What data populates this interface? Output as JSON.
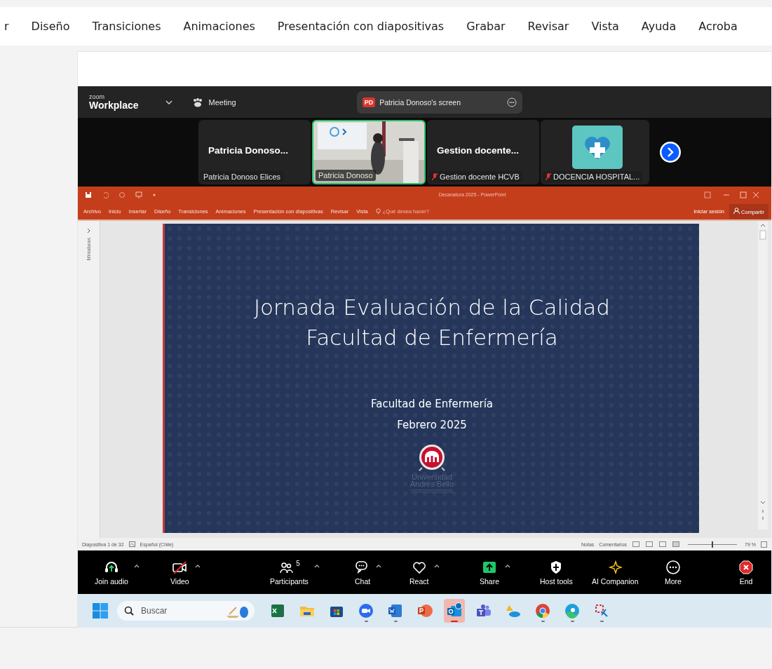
{
  "menu": [
    {
      "label": "r"
    },
    {
      "label": "Diseño"
    },
    {
      "label": "Transiciones"
    },
    {
      "label": "Animaciones"
    },
    {
      "label": "Presentación con diapositivas"
    },
    {
      "label": "Grabar"
    },
    {
      "label": "Revisar"
    },
    {
      "label": "Vista"
    },
    {
      "label": "Ayuda"
    },
    {
      "label": "Acroba"
    }
  ],
  "zoom_header": {
    "brand_small": "zoom",
    "brand": "Workplace",
    "meeting": "Meeting",
    "share_pill": {
      "initials": "PD",
      "label": "Patricia Donoso's screen"
    }
  },
  "participants": [
    {
      "kind": "name",
      "title": "Patricia Donoso...",
      "caption": "Patricia Donoso Elices",
      "muted": false,
      "selected": false
    },
    {
      "kind": "video",
      "caption": "Patricia Donoso",
      "muted": false,
      "selected": true
    },
    {
      "kind": "name",
      "title": "Gestion docente...",
      "caption": "Gestion docente HCVB",
      "muted": true,
      "selected": false
    },
    {
      "kind": "avatar",
      "caption": "DOCENCIA HOSPITAL...",
      "muted": true,
      "selected": false
    }
  ],
  "powerpoint": {
    "title": "Decanatura 2025 - PowerPoint",
    "tabs": [
      "Archivo",
      "Inicio",
      "Insertar",
      "Diseño",
      "Transiciones",
      "Animaciones",
      "Presentación con diapositivas",
      "Revisar",
      "Vista"
    ],
    "tell_me": "¿Qué desea hacer?",
    "sign_in": "Iniciar sesión",
    "share": "Compartir",
    "thumbnails": "Miniaturas",
    "slide": {
      "title": [
        "Jornada Evaluación de la Calidad",
        "Facultad de Enfermería"
      ],
      "subtitle": [
        "Facultad de Enfermería",
        "Febrero 2025"
      ],
      "logo_text": [
        "Universidad",
        "Andrés Bello"
      ]
    },
    "status_bar": {
      "slide": "Diapositiva 1 de 32",
      "language": "Español (Chile)",
      "notes": "Notas",
      "comments": "Comentarios",
      "zoom": "79 %",
      "level": 0.5
    }
  },
  "toolbar": [
    {
      "kind": "audio",
      "label": "Join audio",
      "caret": true
    },
    {
      "kind": "video",
      "label": "Video",
      "caret": true,
      "muted": true
    },
    {
      "kind": "participants",
      "label": "Participants",
      "count": "5",
      "caret": true
    },
    {
      "kind": "chat",
      "label": "Chat",
      "caret": true
    },
    {
      "kind": "react",
      "label": "React",
      "caret": true
    },
    {
      "kind": "share",
      "label": "Share",
      "caret": true
    },
    {
      "kind": "host",
      "label": "Host tools",
      "caret": false
    },
    {
      "kind": "ai",
      "label": "AI Companion",
      "caret": false
    },
    {
      "kind": "more",
      "label": "More",
      "caret": false
    },
    {
      "kind": "end",
      "label": "End",
      "caret": false
    }
  ],
  "taskbar": {
    "search": {
      "placeholder": "Buscar"
    },
    "apps": [
      {
        "kind": "excel",
        "running": false,
        "selected": false
      },
      {
        "kind": "folder",
        "running": false,
        "selected": false
      },
      {
        "kind": "store",
        "running": false,
        "selected": false
      },
      {
        "kind": "zoom",
        "running": true,
        "selected": false
      },
      {
        "kind": "word",
        "running": true,
        "selected": false
      },
      {
        "kind": "powerpoint",
        "running": false,
        "selected": false
      },
      {
        "kind": "outlook",
        "running": true,
        "selected": true
      },
      {
        "kind": "teams",
        "running": false,
        "selected": false
      },
      {
        "kind": "cloud",
        "running": false,
        "selected": false
      },
      {
        "kind": "chrome",
        "running": true,
        "selected": false
      },
      {
        "kind": "edge",
        "running": true,
        "selected": false
      },
      {
        "kind": "snip",
        "running": true,
        "selected": false
      }
    ]
  }
}
